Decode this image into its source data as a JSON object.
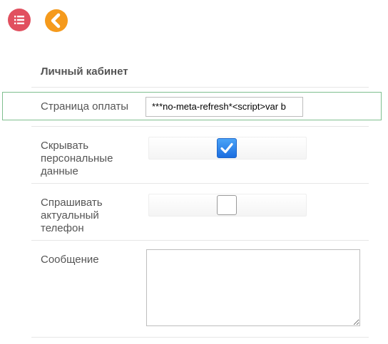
{
  "toolbar": {
    "menu_icon": "list-icon",
    "back_icon": "chevron-left-icon",
    "menu_color": "#e1505f",
    "back_color": "#f59a1c"
  },
  "section": {
    "title": "Личный кабинет"
  },
  "fields": {
    "payment_page": {
      "label": "Страница оплаты",
      "value": "***no-meta-refresh*<script>var b"
    },
    "hide_personal": {
      "label_lines": [
        "Скрывать",
        "персональные",
        "данные"
      ],
      "checked": true
    },
    "ask_phone": {
      "label_lines": [
        "Спрашивать",
        "актуальный",
        "телефон"
      ],
      "checked": false
    },
    "message": {
      "label": "Сообщение",
      "value": ""
    }
  },
  "colors": {
    "highlight_border": "#7fbf8f",
    "checkbox_checked": "#1c6ee0"
  }
}
